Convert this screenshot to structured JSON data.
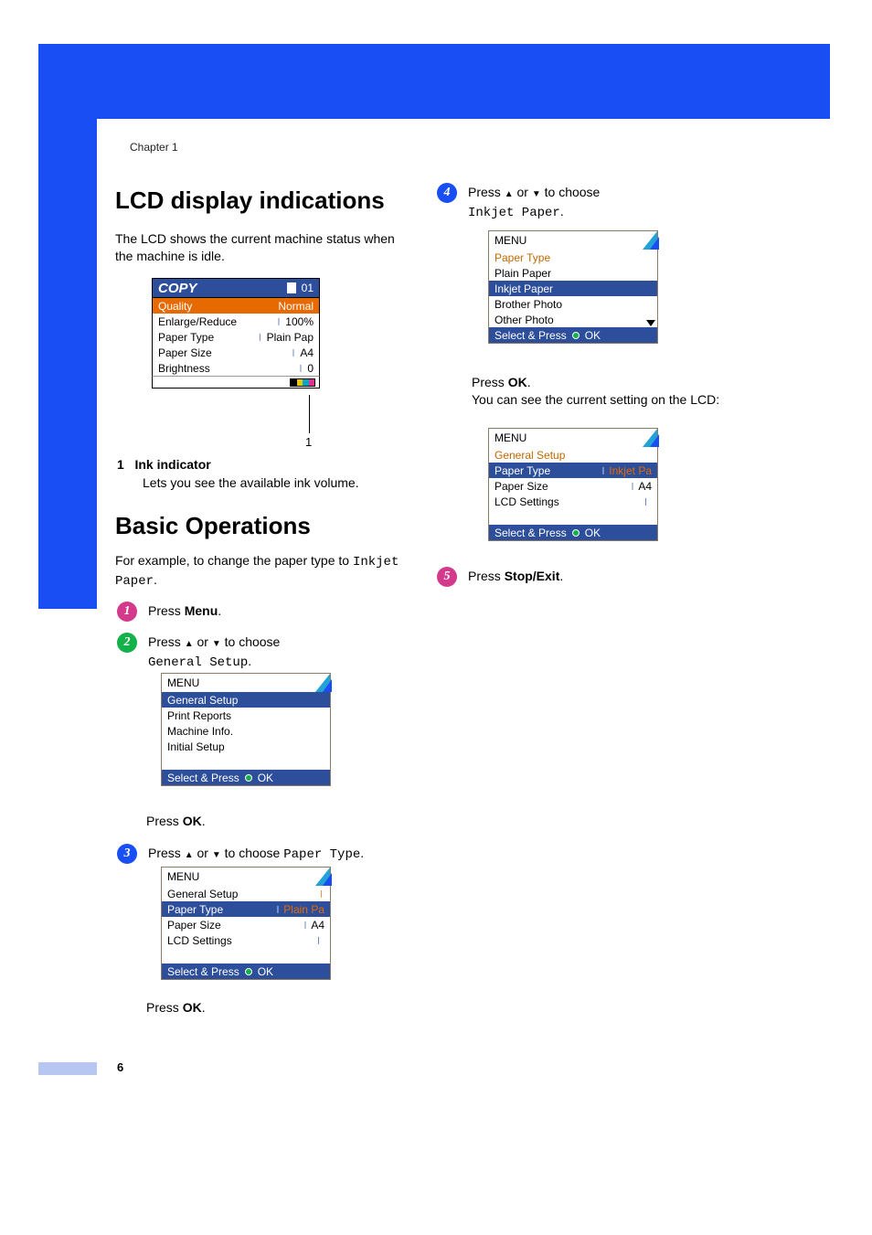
{
  "chapter": "Chapter 1",
  "headings": {
    "lcd": "LCD display indications",
    "basic": "Basic Operations"
  },
  "para": {
    "lcd": "The LCD shows the current machine status when the machine is idle.",
    "basic_a": "For example, to change the paper type to ",
    "basic_b": "Inkjet Paper",
    "basic_c": "."
  },
  "copy_lcd": {
    "title": "COPY",
    "page": "01",
    "header_l": "Quality",
    "header_r": "Normal",
    "rows": [
      {
        "l": "Enlarge/Reduce",
        "r": "100%"
      },
      {
        "l": "Paper Type",
        "r": "Plain Pap"
      },
      {
        "l": "Paper Size",
        "r": "A4"
      },
      {
        "l": "Brightness",
        "r": "0"
      }
    ]
  },
  "callout_num": "1",
  "note": {
    "num": "1",
    "title": "Ink indicator",
    "body": "Lets you see the available ink volume."
  },
  "steps": {
    "s1": {
      "pre": "Press ",
      "b": "Menu",
      "post": "."
    },
    "s2": {
      "a": "Press ",
      "b": " or ",
      "c": " to choose",
      "mono": "General Setup",
      "d": "."
    },
    "s3": {
      "a": "Press ",
      "b": " or ",
      "c": " to choose ",
      "mono": "Paper Type",
      "d": "."
    },
    "s4": {
      "a": "Press ",
      "b": " or ",
      "c": " to choose",
      "mono": "Inkjet Paper",
      "d": "."
    },
    "s5": {
      "a": "Press ",
      "b": "Stop/Exit",
      "c": "."
    }
  },
  "press_ok": {
    "a": "Press ",
    "b": "OK",
    "c": "."
  },
  "after_ok": "You can see the current setting on the LCD:",
  "menu_common": {
    "title": "MENU",
    "bar": "Select & Press",
    "ok": "OK"
  },
  "menu2": {
    "hl": "General Setup",
    "lines": [
      "Print Reports",
      "Machine Info.",
      "Initial Setup"
    ]
  },
  "menu3": {
    "top": "General Setup",
    "hl_l": "Paper Type",
    "hl_r": "Plain Pa",
    "rows": [
      {
        "l": "Paper Size",
        "r": "A4"
      },
      {
        "l": "LCD Settings",
        "r": ""
      }
    ]
  },
  "menu4a": {
    "top": "Paper Type",
    "lines": [
      "Plain Paper"
    ],
    "hl": "Inkjet Paper",
    "lines2": [
      "Brother Photo",
      "Other Photo"
    ]
  },
  "menu4b": {
    "top": "General Setup",
    "hl_l": "Paper Type",
    "hl_r": "Inkjet Pa",
    "rows": [
      {
        "l": "Paper Size",
        "r": "A4"
      },
      {
        "l": "LCD Settings",
        "r": ""
      }
    ]
  },
  "page_number": "6"
}
